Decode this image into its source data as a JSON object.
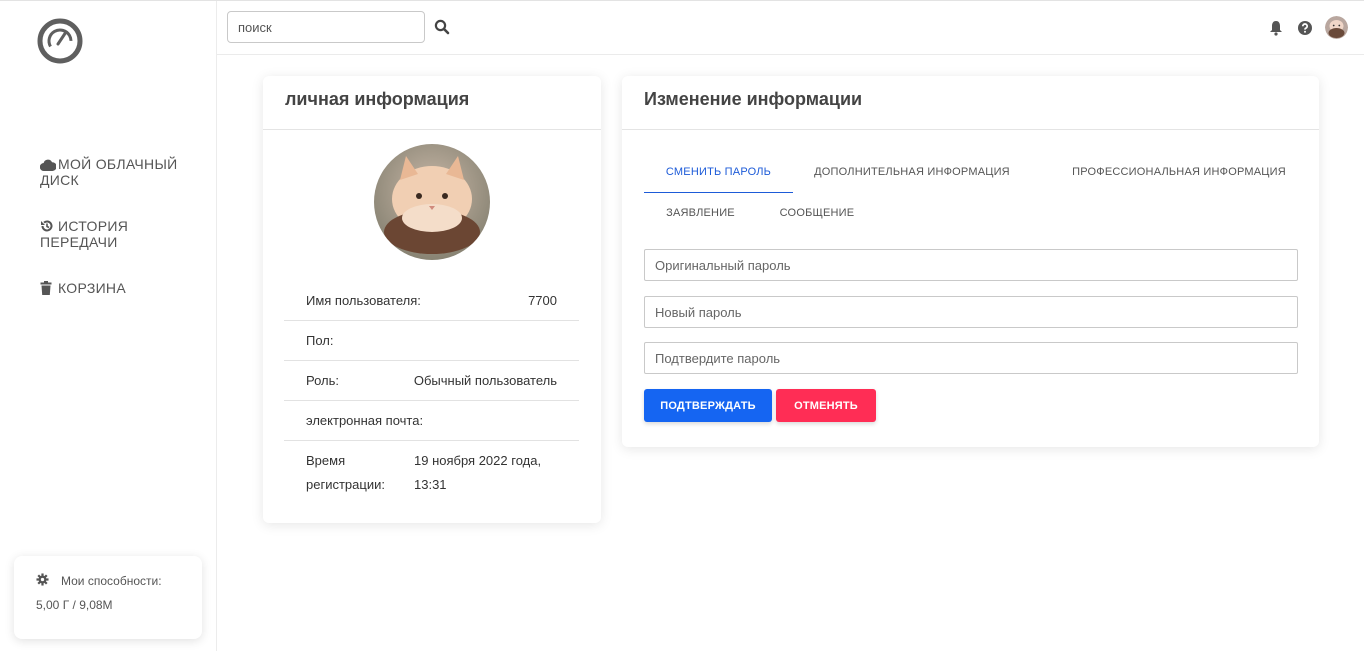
{
  "sidebar": {
    "logo": "speedometer-logo",
    "items": [
      {
        "icon": "cloud-icon",
        "label": "МОЙ ОБЛАЧНЫЙ ДИСК"
      },
      {
        "icon": "history-icon",
        "label": "ИСТОРИЯ ПЕРЕДАЧИ"
      },
      {
        "icon": "trash-icon",
        "label": "КОРЗИНА"
      }
    ],
    "ability": {
      "icon": "gear-icon",
      "label": "Мои способности:",
      "value": "5,00 Г / 9,08М"
    }
  },
  "topbar": {
    "search_placeholder": "поиск",
    "search_icon": "search-icon",
    "icons": [
      "bell-icon",
      "help-icon",
      "user-avatar"
    ]
  },
  "personal": {
    "title": "личная информация",
    "rows": [
      {
        "label": "Имя пользователя:",
        "value": "7700"
      },
      {
        "label": "Пол:",
        "value": ""
      },
      {
        "label": "Роль:",
        "value": "Обычный пользователь"
      },
      {
        "label": "электронная почта:",
        "value": ""
      },
      {
        "label": "Время регистрации:",
        "value": "19 ноября 2022 года, 13:31"
      }
    ]
  },
  "edit": {
    "title": "Изменение информации",
    "tabs": [
      {
        "label": "СМЕНИТЬ ПАРОЛЬ",
        "active": true
      },
      {
        "label": "ДОПОЛНИТЕЛЬНАЯ ИНФОРМАЦИЯ",
        "active": false
      },
      {
        "label": "ПРОФЕССИОНАЛЬНАЯ ИНФОРМАЦИЯ",
        "active": false
      },
      {
        "label": "ЗАЯВЛЕНИЕ",
        "active": false
      },
      {
        "label": "СООБЩЕНИЕ",
        "active": false
      }
    ],
    "fields": [
      {
        "placeholder": "Оригинальный пароль",
        "value": ""
      },
      {
        "placeholder": "Новый пароль",
        "value": ""
      },
      {
        "placeholder": "Подтвердите пароль",
        "value": ""
      }
    ],
    "confirm_label": "ПОДТВЕРЖДАТЬ",
    "cancel_label": "ОТМЕНЯТЬ"
  },
  "colors": {
    "primary": "#1565f2",
    "danger": "#ff2d55",
    "active_tab": "#1d5bd8"
  }
}
